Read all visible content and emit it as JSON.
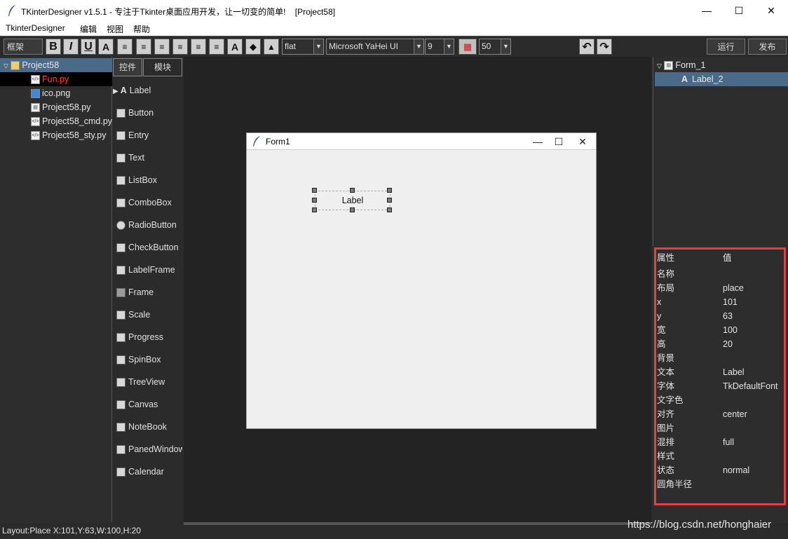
{
  "window": {
    "title": "TKinterDesigner v1.5.1 - 专注于Tkinter桌面应用开发，让一切变的简单!    [Project58]",
    "min_glyph": "—",
    "max_glyph": "☐",
    "close_glyph": "✕"
  },
  "menu": {
    "items": [
      "TkinterDesigner",
      "编辑",
      "视图",
      "帮助"
    ]
  },
  "toolbar": {
    "frame_label": "框架",
    "bold": "B",
    "italic": "I",
    "underline": "U",
    "relief_value": "flat",
    "font_value": "Microsoft YaHei UI",
    "size_value": "9",
    "grid_value": "50",
    "run_label": "运行",
    "publish_label": "发布"
  },
  "project_tree": {
    "root": "Project58",
    "files": [
      {
        "name": "Fun.py",
        "selected": true,
        "color": "#ff3b3b"
      },
      {
        "name": "ico.png",
        "selected": false,
        "color": "#e8e8e8"
      },
      {
        "name": "Project58.py",
        "selected": false,
        "color": "#e8e8e8"
      },
      {
        "name": "Project58_cmd.py",
        "selected": false,
        "color": "#e8e8e8"
      },
      {
        "name": "Project58_sty.py",
        "selected": false,
        "color": "#e8e8e8"
      }
    ]
  },
  "tabs": [
    "控件",
    "模块"
  ],
  "palette": [
    "Label",
    "Button",
    "Entry",
    "Text",
    "ListBox",
    "ComboBox",
    "RadioButton",
    "CheckButton",
    "LabelFrame",
    "Frame",
    "Scale",
    "Progress",
    "SpinBox",
    "TreeView",
    "Canvas",
    "NoteBook",
    "PanedWindow",
    "Calendar"
  ],
  "form": {
    "title": "Form1",
    "label_text": "Label"
  },
  "object_tree": {
    "root": "Form_1",
    "child": "Label_2"
  },
  "properties": {
    "header_key": "属性",
    "header_value": "值",
    "rows": [
      {
        "k": "名称",
        "v": ""
      },
      {
        "k": "布局",
        "v": "place"
      },
      {
        "k": "x",
        "v": "101"
      },
      {
        "k": "y",
        "v": "63"
      },
      {
        "k": "宽",
        "v": "100"
      },
      {
        "k": "高",
        "v": "20"
      },
      {
        "k": "背景",
        "v": ""
      },
      {
        "k": "文本",
        "v": "Label"
      },
      {
        "k": "字体",
        "v": "TkDefaultFont"
      },
      {
        "k": "文字色",
        "v": ""
      },
      {
        "k": "对齐",
        "v": "center"
      },
      {
        "k": "图片",
        "v": ""
      },
      {
        "k": "混排",
        "v": "full"
      },
      {
        "k": "样式",
        "v": ""
      },
      {
        "k": "状态",
        "v": "normal"
      },
      {
        "k": "圆角半径",
        "v": ""
      }
    ]
  },
  "status": "Layout:Place  X:101,Y:63,W:100,H:20",
  "watermark": "https://blog.csdn.net/honghaier",
  "colors": {
    "accent_red": "#e04040",
    "selected_row": "#4a6a8a"
  }
}
